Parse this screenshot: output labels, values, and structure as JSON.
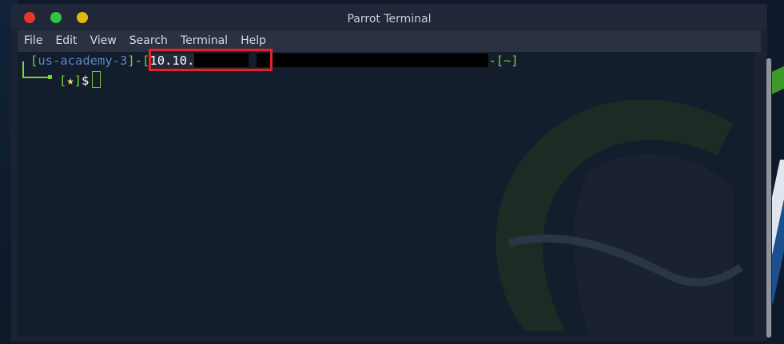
{
  "window": {
    "title": "Parrot Terminal"
  },
  "menu": [
    "File",
    "Edit",
    "View",
    "Search",
    "Terminal",
    "Help"
  ],
  "prompt": {
    "open_bracket": "[",
    "host": "us-academy-3",
    "close_bracket": "]",
    "separator": "-",
    "ip_open": "[",
    "ip": "10.10.",
    "path": "-[~]",
    "line2_open": "[",
    "star": "★",
    "line2_close": "]",
    "dollar": "$"
  },
  "colors": {
    "close": "#e8362e",
    "minimize": "#31c447",
    "maximize": "#e2b90f",
    "highlight": "#e3222a",
    "prompt_green": "#7fcf3a",
    "host_blue": "#5a86c7"
  }
}
